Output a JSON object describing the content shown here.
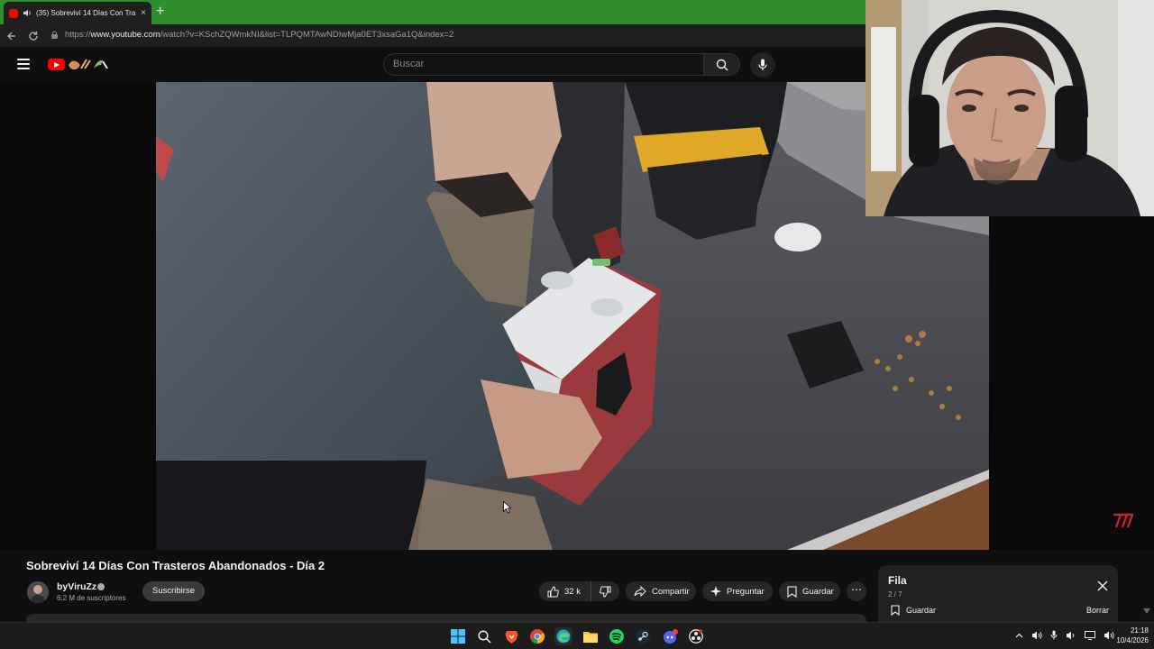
{
  "browser": {
    "tab_title": "(35) Sobreviví 14 Días Con Tra",
    "tab_close": "×",
    "new_tab": "+",
    "url_prefix": "https://",
    "url_domain": "www.youtube.com",
    "url_path": "/watch?v=KSchZQWmkNI&list=TLPQMTAwNDIwMja0ET3xsaGa1Q&index=2",
    "tab_bar_color": "#2f8f2f"
  },
  "youtube": {
    "search_placeholder": "Buscar",
    "logo_color": "#ff0000"
  },
  "video": {
    "title": "Sobreviví 14 Días Con Trasteros Abandonados - Día 2",
    "channel_name": "byViruZz",
    "subscribers": "6.2 M de suscriptores",
    "subscribe_label": "Suscribirse",
    "likes": "32 k",
    "share_label": "Compartir",
    "ask_label": "Preguntar",
    "save_label": "Guardar",
    "more_label": "⋯"
  },
  "queue": {
    "title": "Fila",
    "position": "2 / 7",
    "save_label": "Guardar",
    "clear_label": "Borrar"
  },
  "taskbar": {
    "icons": [
      "windows-start-icon",
      "search-icon",
      "brave-browser-icon",
      "chrome-icon",
      "edge-icon",
      "file-explorer-icon",
      "spotify-icon",
      "steam-icon",
      "discord-icon",
      "obs-icon"
    ],
    "tray_icons": [
      "chevron-up-icon",
      "speaker-icon",
      "microphone-icon",
      "volume-icon",
      "display-icon",
      "network-icon"
    ],
    "time": "21:18",
    "date": "10/4/2026"
  }
}
